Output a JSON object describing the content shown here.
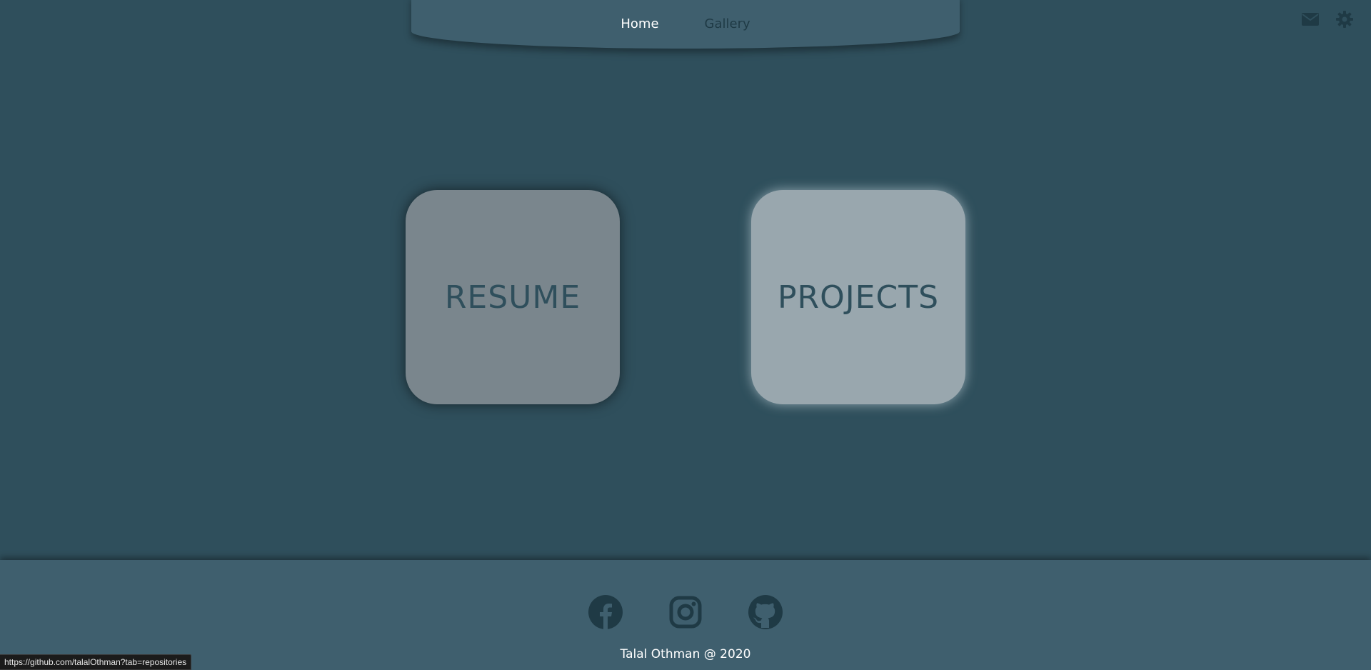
{
  "nav": {
    "items": [
      {
        "label": "Home",
        "active": true
      },
      {
        "label": "Gallery",
        "active": false
      }
    ]
  },
  "top_icons": [
    "envelope-icon",
    "gear-icon"
  ],
  "cards": {
    "resume_label": "RESUME",
    "projects_label": "PROJECTS"
  },
  "footer": {
    "social_icons": [
      "facebook-icon",
      "instagram-icon",
      "github-icon"
    ],
    "copyright": "Talal Othman @ 2020"
  },
  "status_url": "https://github.com/talalOthman?tab=repositories",
  "colors": {
    "background": "#2f4f5c",
    "nav_footer": "#3f5f6e",
    "resume_card": "#7a868d",
    "projects_card": "#99a7ae",
    "icon_dark": "#1f3a45"
  }
}
